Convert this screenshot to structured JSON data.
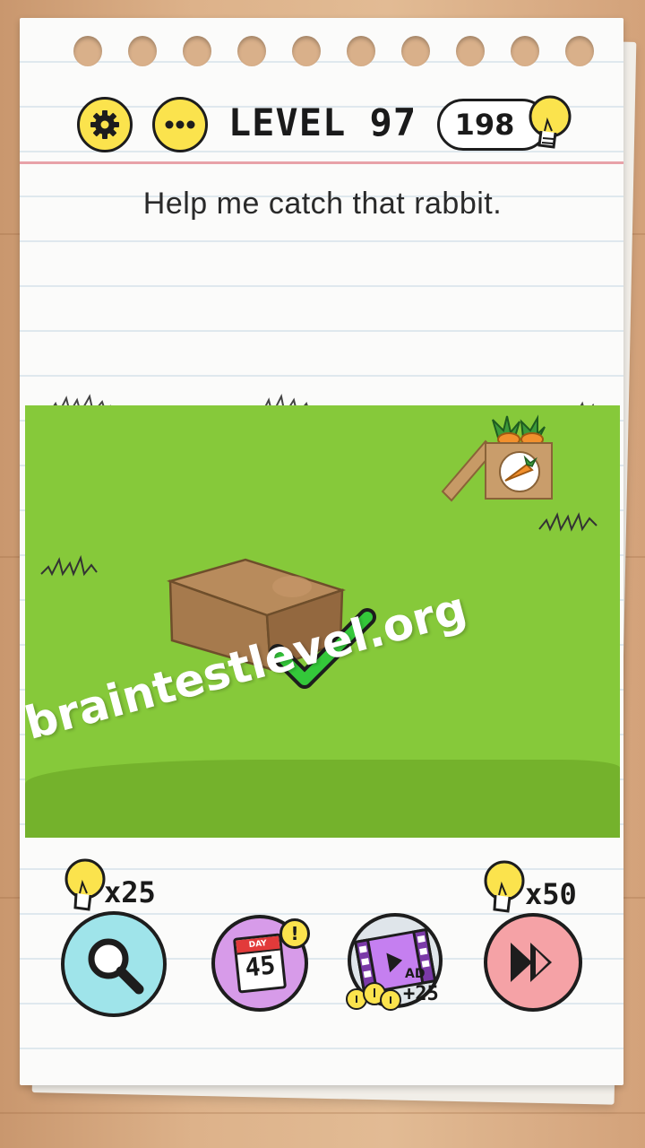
{
  "header": {
    "level_label": "LEVEL 97",
    "hints_count": "198"
  },
  "question": "Help me catch that rabbit.",
  "watermark": "braintestlevel.org",
  "calendar": {
    "day_label": "DAY",
    "day_number": "45",
    "alert_mark": "!"
  },
  "video_reward": {
    "ad_label": "AD",
    "reward": "+25"
  },
  "hint_tool": {
    "cost": "x25"
  },
  "skip_tool": {
    "cost": "x50"
  },
  "colors": {
    "grass": "#86c93a",
    "yellow_button": "#fbe34d",
    "search_button": "#9fe4ea",
    "calendar_button": "#d79be9",
    "video_button": "#dfe5ea",
    "skip_button": "#f5a2a6",
    "check": "#34c83a"
  }
}
